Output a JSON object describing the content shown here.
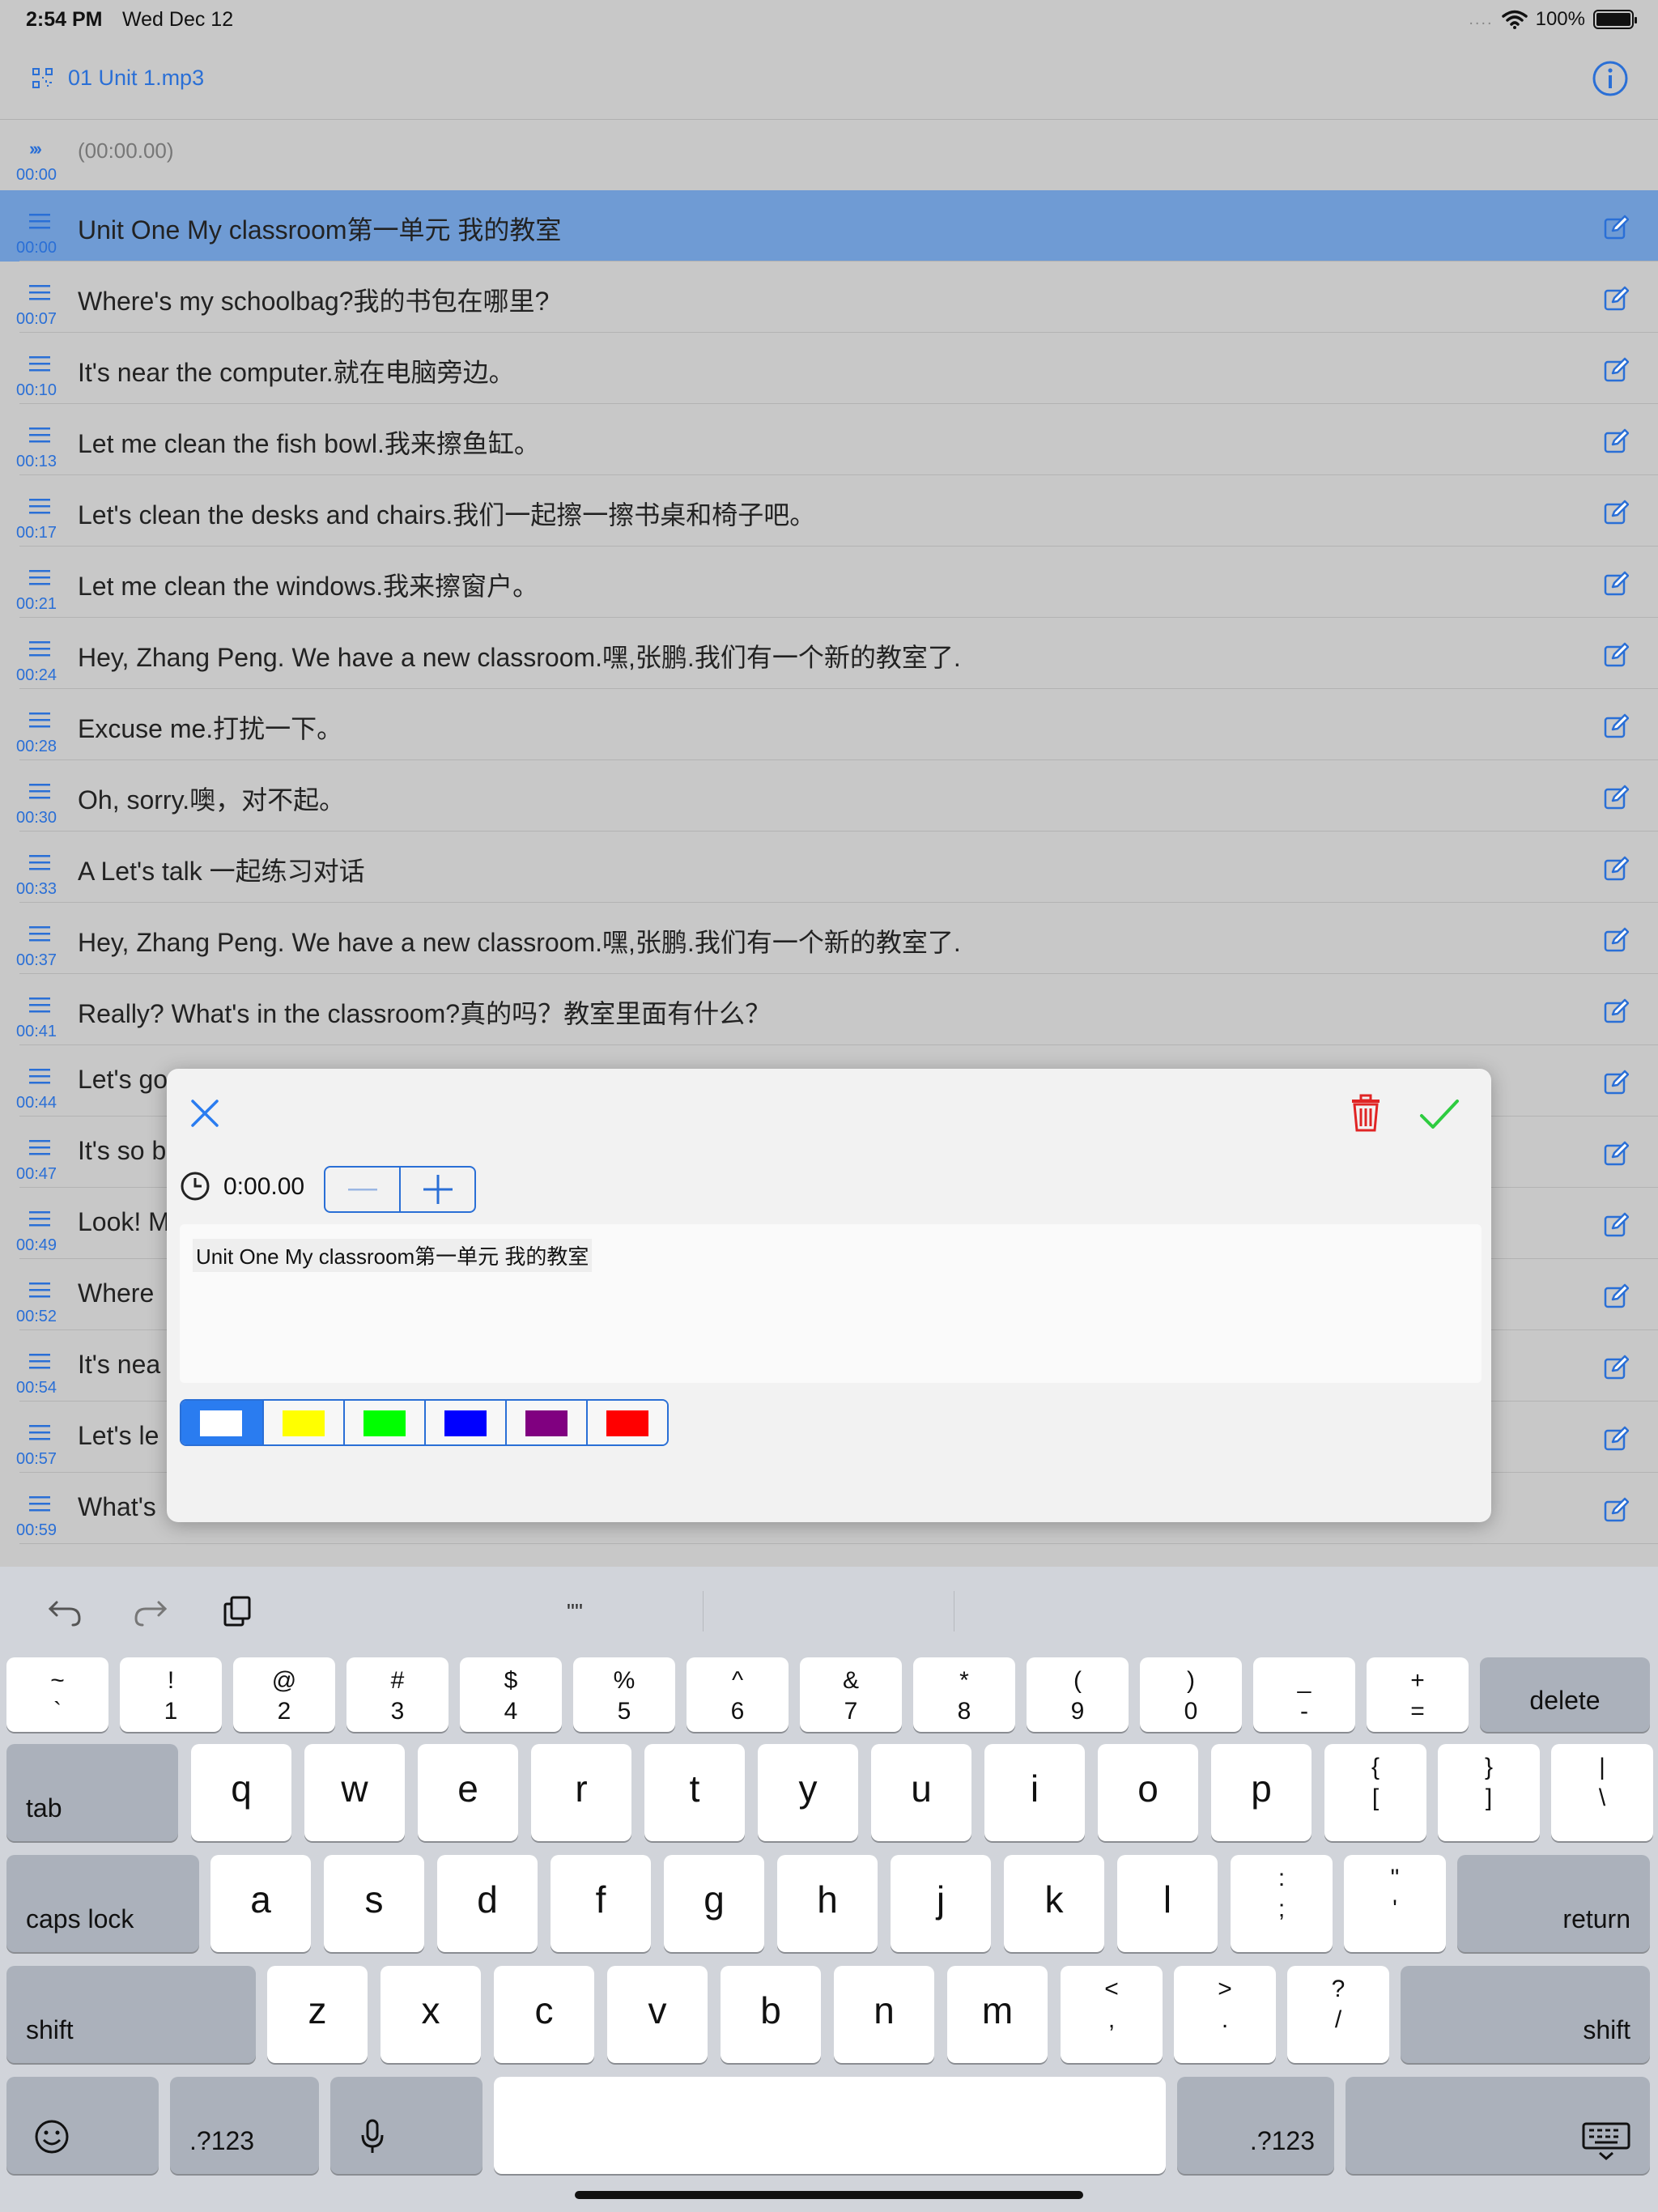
{
  "status": {
    "time": "2:54 PM",
    "date": "Wed Dec 12",
    "dots": "....",
    "battery": "100%"
  },
  "nav": {
    "title": "01 Unit 1.mp3",
    "file_icon": "waveform-file-icon",
    "info_icon": "info-icon"
  },
  "now_playing": {
    "time": "00:00",
    "text": "(00:00.00)"
  },
  "rows": [
    {
      "time": "00:00",
      "text": "Unit One My classroom第一单元 我的教室"
    },
    {
      "time": "00:07",
      "text": "Where's my schoolbag?我的书包在哪里?"
    },
    {
      "time": "00:10",
      "text": "It's near the computer.就在电脑旁边。"
    },
    {
      "time": "00:13",
      "text": "Let me clean the fish bowl.我来擦鱼缸。"
    },
    {
      "time": "00:17",
      "text": "Let's clean the desks and chairs.我们一起擦一擦书桌和椅子吧。"
    },
    {
      "time": "00:21",
      "text": "Let me clean the windows.我来擦窗户。"
    },
    {
      "time": "00:24",
      "text": "Hey, Zhang Peng. We have a new classroom.嘿,张鹏.我们有一个新的教室了."
    },
    {
      "time": "00:28",
      "text": "Excuse me.打扰一下。"
    },
    {
      "time": "00:30",
      "text": "Oh, sorry.噢，对不起。"
    },
    {
      "time": "00:33",
      "text": "A Let's talk 一起练习对话"
    },
    {
      "time": "00:37",
      "text": "Hey, Zhang Peng. We have a new classroom.嘿,张鹏.我们有一个新的教室了."
    },
    {
      "time": "00:41",
      "text": "Really? What's in the classroom?真的吗？教室里面有什么？"
    },
    {
      "time": "00:44",
      "text": "Let's go"
    },
    {
      "time": "00:47",
      "text": "It's so b"
    },
    {
      "time": "00:49",
      "text": "Look! M"
    },
    {
      "time": "00:52",
      "text": "Where"
    },
    {
      "time": "00:54",
      "text": "It's nea"
    },
    {
      "time": "00:57",
      "text": "Let's le"
    },
    {
      "time": "00:59",
      "text": "What's"
    }
  ],
  "editor": {
    "time_value": "0:00.00",
    "text": "Unit One My classroom第一单元 我的教室",
    "colors": [
      "#ffffff",
      "#ffff00",
      "#00ff00",
      "#0000ff",
      "#800080",
      "#ff0000"
    ],
    "selected_color_index": 0
  },
  "keyboard": {
    "quote": "\"\"",
    "row1": [
      {
        "top": "~",
        "bottom": "`"
      },
      {
        "top": "!",
        "bottom": "1"
      },
      {
        "top": "@",
        "bottom": "2"
      },
      {
        "top": "#",
        "bottom": "3"
      },
      {
        "top": "$",
        "bottom": "4"
      },
      {
        "top": "%",
        "bottom": "5"
      },
      {
        "top": "^",
        "bottom": "6"
      },
      {
        "top": "&",
        "bottom": "7"
      },
      {
        "top": "*",
        "bottom": "8"
      },
      {
        "top": "(",
        "bottom": "9"
      },
      {
        "top": ")",
        "bottom": "0"
      },
      {
        "top": "_",
        "bottom": "-"
      },
      {
        "top": "+",
        "bottom": "="
      }
    ],
    "delete": "delete",
    "tab": "tab",
    "row2": [
      "q",
      "w",
      "e",
      "r",
      "t",
      "y",
      "u",
      "i",
      "o",
      "p"
    ],
    "row2_symbols": [
      {
        "top": "{",
        "bottom": "["
      },
      {
        "top": "}",
        "bottom": "]"
      },
      {
        "top": "|",
        "bottom": "\\"
      }
    ],
    "caps_lock": "caps lock",
    "row3": [
      "a",
      "s",
      "d",
      "f",
      "g",
      "h",
      "j",
      "k",
      "l"
    ],
    "row3_symbols": [
      {
        "top": ":",
        "bottom": ";"
      },
      {
        "top": "\"",
        "bottom": "'"
      }
    ],
    "return": "return",
    "shift": "shift",
    "row4": [
      "z",
      "x",
      "c",
      "v",
      "b",
      "n",
      "m"
    ],
    "row4_symbols": [
      {
        "top": "<",
        "bottom": ","
      },
      {
        "top": ">",
        "bottom": "."
      },
      {
        "top": "?",
        "bottom": "/"
      }
    ],
    "numbers": ".?123"
  }
}
